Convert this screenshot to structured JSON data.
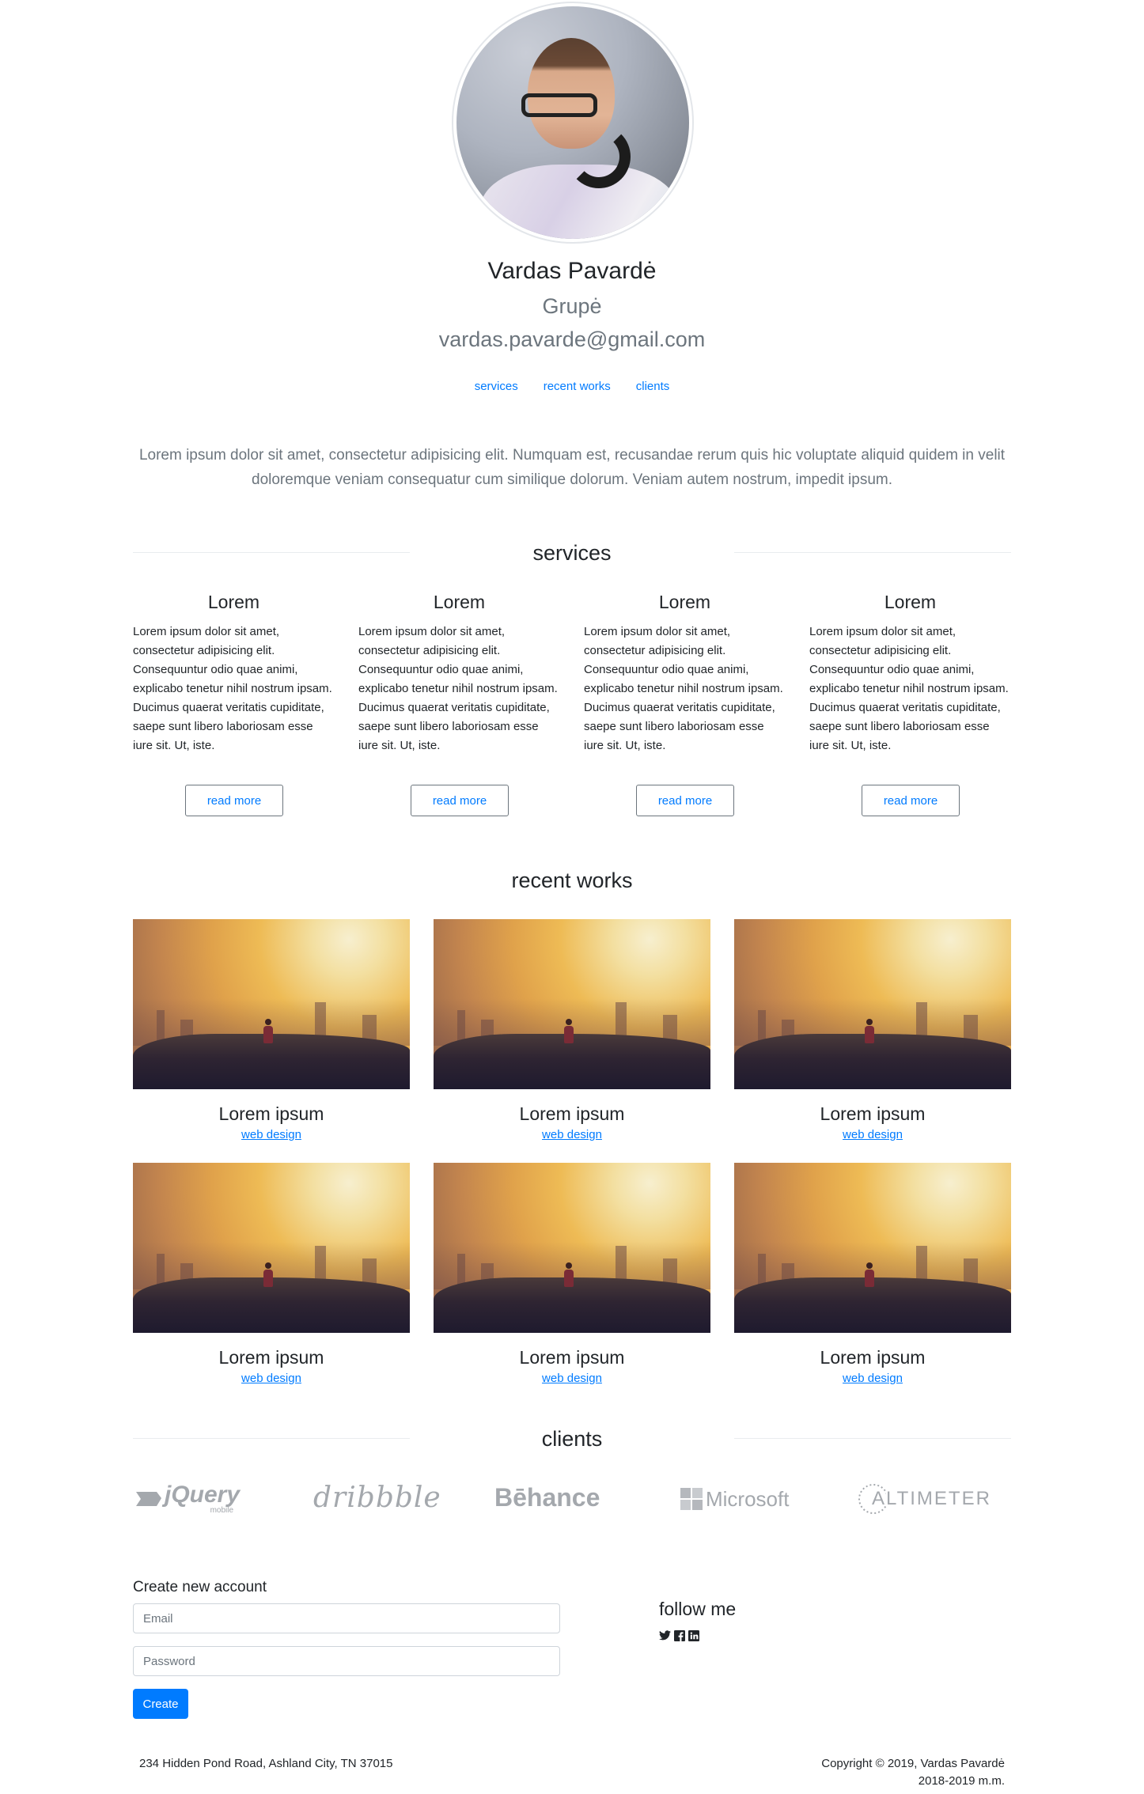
{
  "profile": {
    "name": "Vardas Pavardė",
    "group": "Grupė",
    "email": "vardas.pavarde@gmail.com"
  },
  "nav": {
    "items": [
      "services",
      "recent works",
      "clients"
    ]
  },
  "intro": "Lorem ipsum dolor sit amet, consectetur adipisicing elit. Numquam est, recusandae rerum quis hic voluptate aliquid quidem in velit doloremque veniam consequatur cum similique dolorum. Veniam autem nostrum, impedit ipsum.",
  "services": {
    "title": "services",
    "items": [
      {
        "title": "Lorem",
        "text": "Lorem ipsum dolor sit amet, consectetur adipisicing elit. Consequuntur odio quae animi, explicabo tenetur nihil nostrum ipsam. Ducimus quaerat veritatis cupiditate, saepe sunt libero laboriosam esse iure sit. Ut, iste.",
        "button": "read more"
      },
      {
        "title": "Lorem",
        "text": "Lorem ipsum dolor sit amet, consectetur adipisicing elit. Consequuntur odio quae animi, explicabo tenetur nihil nostrum ipsam. Ducimus quaerat veritatis cupiditate, saepe sunt libero laboriosam esse iure sit. Ut, iste.",
        "button": "read more"
      },
      {
        "title": "Lorem",
        "text": "Lorem ipsum dolor sit amet, consectetur adipisicing elit. Consequuntur odio quae animi, explicabo tenetur nihil nostrum ipsam. Ducimus quaerat veritatis cupiditate, saepe sunt libero laboriosam esse iure sit. Ut, iste.",
        "button": "read more"
      },
      {
        "title": "Lorem",
        "text": "Lorem ipsum dolor sit amet, consectetur adipisicing elit. Consequuntur odio quae animi, explicabo tenetur nihil nostrum ipsam. Ducimus quaerat veritatis cupiditate, saepe sunt libero laboriosam esse iure sit. Ut, iste.",
        "button": "read more"
      }
    ]
  },
  "works": {
    "title": "recent works",
    "items": [
      {
        "title": "Lorem ipsum",
        "tag": "web design"
      },
      {
        "title": "Lorem ipsum",
        "tag": "web design"
      },
      {
        "title": "Lorem ipsum",
        "tag": "web design"
      },
      {
        "title": "Lorem ipsum",
        "tag": "web design"
      },
      {
        "title": "Lorem ipsum",
        "tag": "web design"
      },
      {
        "title": "Lorem ipsum",
        "tag": "web design"
      }
    ]
  },
  "clients": {
    "title": "clients",
    "logos": [
      "jQuery",
      "dribbble",
      "Bēhance",
      "Microsoft",
      "ALTIMETER"
    ],
    "jquery_sub": "mobile"
  },
  "signup": {
    "title": "Create new account",
    "email_placeholder": "Email",
    "password_placeholder": "Password",
    "button": "Create"
  },
  "follow": {
    "title": "follow me",
    "icons": [
      "twitter-icon",
      "facebook-icon",
      "linkedin-icon"
    ]
  },
  "footer": {
    "address": "234 Hidden Pond Road, Ashland City, TN 37015",
    "copyright": "Copyright © 2019, Vardas Pavardė",
    "years": "2018-2019 m.m."
  },
  "colors": {
    "accent": "#007bff",
    "muted": "#6c757d",
    "logo_gray": "#a4a8ad"
  }
}
